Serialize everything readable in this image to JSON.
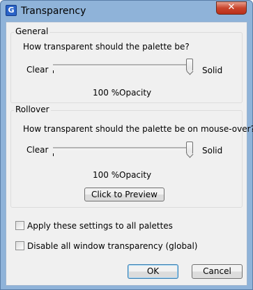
{
  "window": {
    "title": "Transparency",
    "close_symbol": "✕",
    "icon_letter": "G"
  },
  "general": {
    "title": "General",
    "question": "How transparent should the palette be?",
    "min_label": "Clear",
    "max_label": "Solid",
    "value_percent": 100,
    "readout_value": "100 %",
    "readout_unit": "Opacity"
  },
  "rollover": {
    "title": "Rollover",
    "question": "How transparent should the palette be on mouse-over?",
    "min_label": "Clear",
    "max_label": "Solid",
    "value_percent": 100,
    "readout_value": "100 %",
    "readout_unit": "Opacity",
    "preview_button": "Click to Preview"
  },
  "options": {
    "apply_all": {
      "label": "Apply these settings to all palettes",
      "checked": false
    },
    "disable_all": {
      "label": "Disable all window transparency (global)",
      "checked": false
    }
  },
  "buttons": {
    "ok": "OK",
    "cancel": "Cancel"
  }
}
